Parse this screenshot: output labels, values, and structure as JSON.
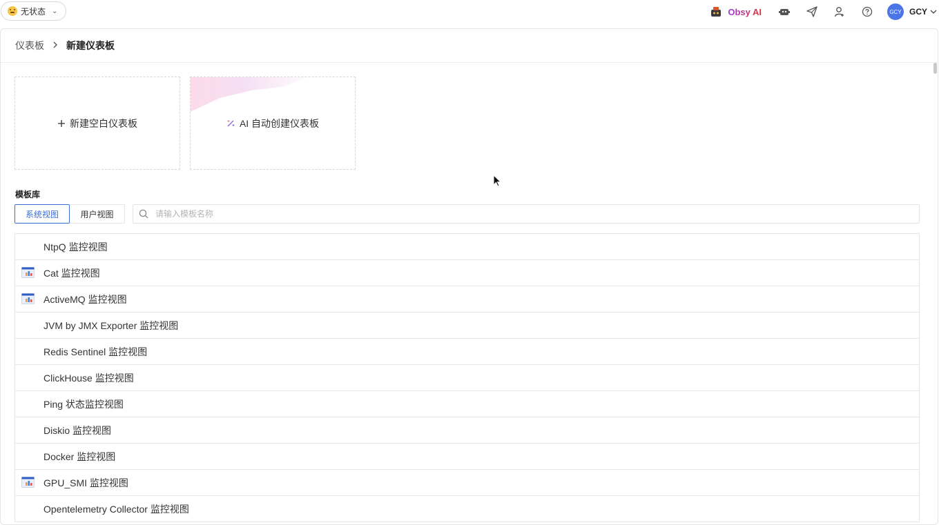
{
  "topbar": {
    "status_label": "无状态",
    "obsy_label": "Obsy AI",
    "user_initials": "GCY",
    "user_name": "GCY"
  },
  "breadcrumb": {
    "root": "仪表板",
    "current": "新建仪表板"
  },
  "cards": {
    "blank_label": "新建空白仪表板",
    "ai_label": "AI 自动创建仪表板"
  },
  "library": {
    "title": "模板库",
    "tabs": [
      "系统视图",
      "用户视图"
    ],
    "active_tab": "系统视图",
    "search_placeholder": "请输入模板名称",
    "items": [
      {
        "name": "NtpQ 监控视图",
        "has_icon": false
      },
      {
        "name": "Cat 监控视图",
        "has_icon": true
      },
      {
        "name": "ActiveMQ 监控视图",
        "has_icon": true
      },
      {
        "name": "JVM by JMX Exporter 监控视图",
        "has_icon": false
      },
      {
        "name": "Redis Sentinel 监控视图",
        "has_icon": false
      },
      {
        "name": "ClickHouse 监控视图",
        "has_icon": false
      },
      {
        "name": "Ping 状态监控视图",
        "has_icon": false
      },
      {
        "name": "Diskio 监控视图",
        "has_icon": false
      },
      {
        "name": "Docker 监控视图",
        "has_icon": false
      },
      {
        "name": "GPU_SMI 监控视图",
        "has_icon": true
      },
      {
        "name": "Opentelemetry Collector 监控视图",
        "has_icon": false
      }
    ]
  },
  "colors": {
    "accent": "#3b6fd8",
    "avatar": "#4b74e6"
  }
}
